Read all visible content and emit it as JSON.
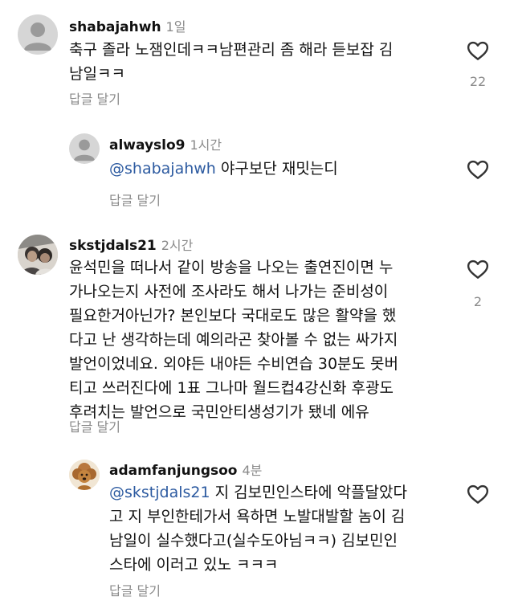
{
  "comments": [
    {
      "username": "shabajahwh",
      "time": "1일",
      "line1": "축구 졸라 노잼인데ㅋㅋ남편관리 좀 해라 듣보잡 김",
      "line2": "남일ㅋㅋ",
      "reply_label": "답글 달기",
      "like_count": "22",
      "avatar": "default-avatar-icon"
    },
    {
      "username": "alwayslo9",
      "time": "1시간",
      "mention": "@shabajahwh",
      "text": " 야구보단 재밋는디",
      "reply_label": "답글 달기",
      "avatar": "default-avatar-icon"
    },
    {
      "username": "skstjdals21",
      "time": "2시간",
      "lines": [
        "윤석민을 떠나서 같이 방송을 나오는 출연진이면 누",
        "가나오는지 사전에 조사라도 해서 나가는 준비성이",
        "필요한거아닌가? 본인보다 국대로도 많은 활약을 했",
        "다고 난 생각하는데 예의라곤 찾아볼 수 없는 싸가지",
        "발언이었네요. 외야든 내야든 수비연습 30분도 못버",
        "티고 쓰러진다에 1표 그나마 월드컵4강신화 후광도",
        "후려치는 발언으로 국민안티생성기가 됐네 에유"
      ],
      "reply_label": "답글 달기",
      "like_count": "2",
      "avatar": "photo-avatar"
    },
    {
      "username": "adamfanjungsoo",
      "time": "4분",
      "mention": "@skstjdals21",
      "line1_rest": " 지 김보민인스타에 악플달았다",
      "lines": [
        "고 지 부인한테가서 욕하면 노발대발할 놈이 김",
        "남일이 실수했다고(실수도아님ㅋㅋ) 김보민인",
        "스타에 이러고 있노 ㅋㅋㅋ"
      ],
      "reply_label": "답글 달기",
      "avatar": "poodle-avatar"
    }
  ]
}
